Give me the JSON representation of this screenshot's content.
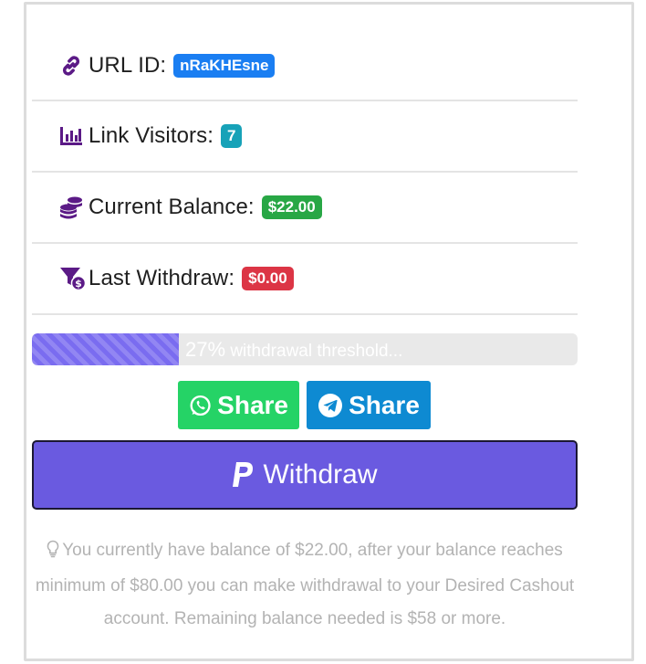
{
  "rows": [
    {
      "label": "URL ID:",
      "badge": "nRaKHEsne",
      "icon": "link-icon"
    },
    {
      "label": "Link Visitors:",
      "badge": "7",
      "icon": "chart-bar-icon"
    },
    {
      "label": "Current Balance:",
      "badge": "$22.00",
      "icon": "coins-icon"
    },
    {
      "label": "Last Withdraw:",
      "badge": "$0.00",
      "icon": "funnel-dollar-icon"
    }
  ],
  "progress": {
    "percent": 27,
    "percent_text": "27%",
    "label": "withdrawal threshold..."
  },
  "share": {
    "whatsapp_label": "Share",
    "telegram_label": "Share"
  },
  "withdraw": {
    "label": "Withdraw",
    "icon": "paypal-icon"
  },
  "note": {
    "text": "You currently have balance of $22.00, after your balance reaches minimum of $80.00 you can make withdrawal to your Desired Cashout account. Remaining balance needed is $58 or more.",
    "icon": "lightbulb-icon"
  },
  "colors": {
    "icon_purple": "#5b1a86",
    "badge_blue": "#1a7ef2",
    "badge_teal": "#17a2b8",
    "badge_green": "#28a745",
    "badge_red": "#dc3545",
    "progress_fill": "#7a6cf0",
    "whatsapp": "#25d366",
    "telegram": "#0e8ad2",
    "withdraw": "#6a5ae0"
  }
}
